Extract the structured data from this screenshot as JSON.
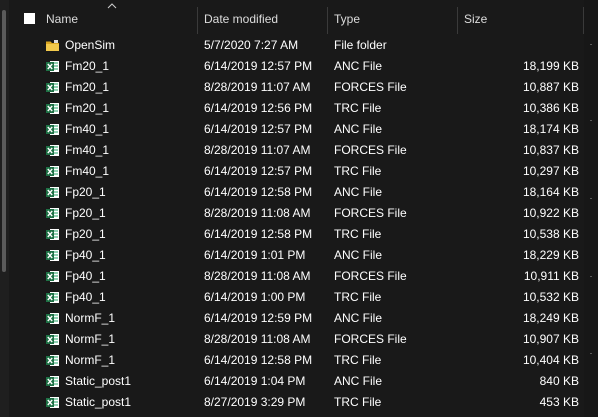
{
  "columns": {
    "name": "Name",
    "date": "Date modified",
    "type": "Type",
    "size": "Size"
  },
  "colors": {
    "background": "#191919",
    "text": "#ffffff",
    "excel_green": "#1e7145",
    "folder_yellow": "#e8b52d"
  },
  "files": [
    {
      "name": "OpenSim",
      "date": "5/7/2020 7:27 AM",
      "type": "File folder",
      "size": "",
      "icon": "folder-icon"
    },
    {
      "name": "Fm20_1",
      "date": "6/14/2019 12:57 PM",
      "type": "ANC File",
      "size": "18,199 KB",
      "icon": "excel-file-icon"
    },
    {
      "name": "Fm20_1",
      "date": "8/28/2019 11:07 AM",
      "type": "FORCES File",
      "size": "10,887 KB",
      "icon": "excel-file-icon"
    },
    {
      "name": "Fm20_1",
      "date": "6/14/2019 12:56 PM",
      "type": "TRC File",
      "size": "10,386 KB",
      "icon": "excel-file-icon"
    },
    {
      "name": "Fm40_1",
      "date": "6/14/2019 12:57 PM",
      "type": "ANC File",
      "size": "18,174 KB",
      "icon": "excel-file-icon"
    },
    {
      "name": "Fm40_1",
      "date": "8/28/2019 11:07 AM",
      "type": "FORCES File",
      "size": "10,837 KB",
      "icon": "excel-file-icon"
    },
    {
      "name": "Fm40_1",
      "date": "6/14/2019 12:57 PM",
      "type": "TRC File",
      "size": "10,297 KB",
      "icon": "excel-file-icon"
    },
    {
      "name": "Fp20_1",
      "date": "6/14/2019 12:58 PM",
      "type": "ANC File",
      "size": "18,164 KB",
      "icon": "excel-file-icon"
    },
    {
      "name": "Fp20_1",
      "date": "8/28/2019 11:08 AM",
      "type": "FORCES File",
      "size": "10,922 KB",
      "icon": "excel-file-icon"
    },
    {
      "name": "Fp20_1",
      "date": "6/14/2019 12:58 PM",
      "type": "TRC File",
      "size": "10,538 KB",
      "icon": "excel-file-icon"
    },
    {
      "name": "Fp40_1",
      "date": "6/14/2019 1:01 PM",
      "type": "ANC File",
      "size": "18,229 KB",
      "icon": "excel-file-icon"
    },
    {
      "name": "Fp40_1",
      "date": "8/28/2019 11:08 AM",
      "type": "FORCES File",
      "size": "10,911 KB",
      "icon": "excel-file-icon"
    },
    {
      "name": "Fp40_1",
      "date": "6/14/2019 1:00 PM",
      "type": "TRC File",
      "size": "10,532 KB",
      "icon": "excel-file-icon"
    },
    {
      "name": "NormF_1",
      "date": "6/14/2019 12:59 PM",
      "type": "ANC File",
      "size": "18,249 KB",
      "icon": "excel-file-icon"
    },
    {
      "name": "NormF_1",
      "date": "8/28/2019 11:08 AM",
      "type": "FORCES File",
      "size": "10,907 KB",
      "icon": "excel-file-icon"
    },
    {
      "name": "NormF_1",
      "date": "6/14/2019 12:58 PM",
      "type": "TRC File",
      "size": "10,404 KB",
      "icon": "excel-file-icon"
    },
    {
      "name": "Static_post1",
      "date": "6/14/2019 1:04 PM",
      "type": "ANC File",
      "size": "840 KB",
      "icon": "excel-file-icon"
    },
    {
      "name": "Static_post1",
      "date": "8/27/2019 3:29 PM",
      "type": "TRC File",
      "size": "453 KB",
      "icon": "excel-file-icon"
    }
  ]
}
